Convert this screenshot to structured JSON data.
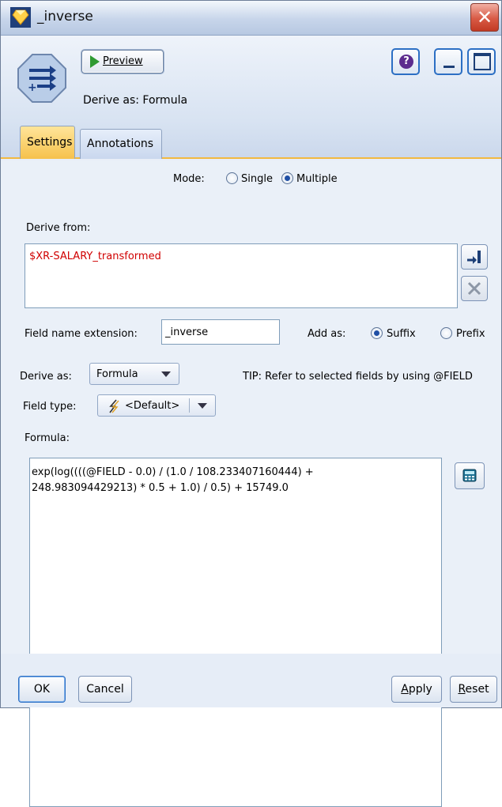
{
  "window": {
    "title": "_inverse",
    "close_symbol": "✕"
  },
  "header": {
    "preview_label": "Preview",
    "derive_as_text": "Derive as: Formula",
    "help_symbol": "?"
  },
  "tabs": [
    {
      "label": "Settings"
    },
    {
      "label": "Annotations"
    }
  ],
  "settings": {
    "mode_label": "Mode:",
    "mode_options": [
      "Single",
      "Multiple"
    ],
    "mode_selected": "Multiple",
    "derive_from_label": "Derive from:",
    "derive_from_fields": [
      "$XR-SALARY_transformed"
    ],
    "field_name_extension_label": "Field name extension:",
    "field_name_extension_value": "_inverse",
    "add_as_label": "Add as:",
    "add_as_options": [
      "Suffix",
      "Prefix"
    ],
    "add_as_selected": "Suffix",
    "derive_as_label": "Derive as:",
    "derive_as_value": "Formula",
    "tip_text": "TIP: Refer to selected fields by using @FIELD",
    "field_type_label": "Field type:",
    "field_type_value": "<Default>",
    "formula_label": "Formula:",
    "formula_lines": [
      "exp(log((((@FIELD - 0.0) / (1.0 / 108.233407160444) +",
      "248.983094429213) * 0.5 + 1.0) / 0.5) + 15749.0"
    ]
  },
  "footer": {
    "ok_label": "OK",
    "cancel_label": "Cancel",
    "apply_label": "Apply",
    "reset_label": "Reset"
  },
  "colors": {
    "field_text": "#d00000",
    "active_tab": "#f6c14b",
    "accent_border": "#2c6fc4"
  }
}
